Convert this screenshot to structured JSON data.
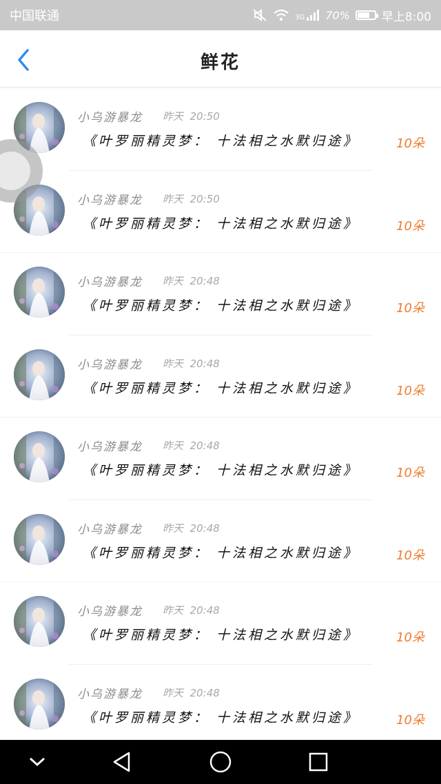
{
  "status_bar": {
    "carrier": "中国联通",
    "network": "3G",
    "battery": "70%",
    "battery_level": 0.7,
    "time": "早上8:00",
    "icons": [
      "mute-icon",
      "wifi-icon",
      "signal-icon",
      "battery-icon"
    ]
  },
  "header": {
    "title": "鲜花",
    "back_icon": "chevron-left-icon",
    "accent_color": "#2f8cf2"
  },
  "colors": {
    "flower_count": "#ee7b2f",
    "username": "#8c8c8c",
    "time": "#a8a8a8",
    "book_title": "#111111"
  },
  "records": [
    {
      "user": "小乌游暴龙",
      "day": "昨天",
      "time": "20:50",
      "book": "《叶罗丽精灵梦： 十法相之水默归途》",
      "count": "10朵"
    },
    {
      "user": "小乌游暴龙",
      "day": "昨天",
      "time": "20:50",
      "book": "《叶罗丽精灵梦： 十法相之水默归途》",
      "count": "10朵"
    },
    {
      "user": "小乌游暴龙",
      "day": "昨天",
      "time": "20:48",
      "book": "《叶罗丽精灵梦： 十法相之水默归途》",
      "count": "10朵"
    },
    {
      "user": "小乌游暴龙",
      "day": "昨天",
      "time": "20:48",
      "book": "《叶罗丽精灵梦： 十法相之水默归途》",
      "count": "10朵"
    },
    {
      "user": "小乌游暴龙",
      "day": "昨天",
      "time": "20:48",
      "book": "《叶罗丽精灵梦： 十法相之水默归途》",
      "count": "10朵"
    },
    {
      "user": "小乌游暴龙",
      "day": "昨天",
      "time": "20:48",
      "book": "《叶罗丽精灵梦： 十法相之水默归途》",
      "count": "10朵"
    },
    {
      "user": "小乌游暴龙",
      "day": "昨天",
      "time": "20:48",
      "book": "《叶罗丽精灵梦： 十法相之水默归途》",
      "count": "10朵"
    },
    {
      "user": "小乌游暴龙",
      "day": "昨天",
      "time": "20:48",
      "book": "《叶罗丽精灵梦： 十法相之水默归途》",
      "count": "10朵"
    }
  ],
  "nav_bar": {
    "icons": [
      "chevron-down-icon",
      "back-triangle-icon",
      "home-circle-icon",
      "recents-square-icon"
    ]
  }
}
